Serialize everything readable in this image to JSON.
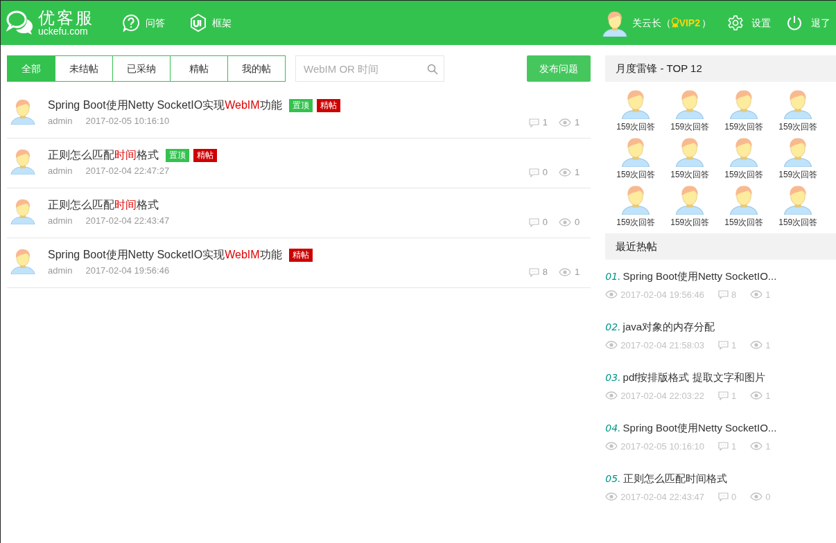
{
  "header": {
    "logo_title": "优客服",
    "logo_subtitle": "uckefu.com",
    "nav": [
      {
        "label": "问答"
      },
      {
        "label": "框架"
      }
    ],
    "user": {
      "name": "关云长（",
      "vip": "VIP2",
      "suffix": "）"
    },
    "actions": [
      {
        "label": "设置"
      },
      {
        "label": "退了"
      }
    ]
  },
  "tabs": [
    {
      "label": "全部",
      "selected": true
    },
    {
      "label": "未结帖",
      "selected": false
    },
    {
      "label": "已采纳",
      "selected": false
    },
    {
      "label": "精帖",
      "selected": false
    },
    {
      "label": "我的帖",
      "selected": false
    }
  ],
  "search": {
    "placeholder": "WebIM OR 时间"
  },
  "post_button": "发布问题",
  "posts": [
    {
      "title": [
        {
          "text": "Spring Boot使用Netty SocketIO实现",
          "highlight": false
        },
        {
          "text": "WebIM",
          "highlight": true
        },
        {
          "text": "功能",
          "highlight": false
        }
      ],
      "badges": [
        {
          "label": "置顶",
          "kind": "top"
        },
        {
          "label": "精帖",
          "kind": "featured"
        }
      ],
      "author": "admin",
      "date": "2017-02-05 10:16:10",
      "comments": "1",
      "views": "1"
    },
    {
      "title": [
        {
          "text": "正则怎么匹配",
          "highlight": false
        },
        {
          "text": "时间",
          "highlight": true
        },
        {
          "text": "格式",
          "highlight": false
        }
      ],
      "badges": [
        {
          "label": "置顶",
          "kind": "top"
        },
        {
          "label": "精帖",
          "kind": "featured"
        }
      ],
      "author": "admin",
      "date": "2017-02-04 22:47:27",
      "comments": "0",
      "views": "1"
    },
    {
      "title": [
        {
          "text": "正则怎么匹配",
          "highlight": false
        },
        {
          "text": "时间",
          "highlight": true
        },
        {
          "text": "格式",
          "highlight": false
        }
      ],
      "author": "admin",
      "date": "2017-02-04 22:43:47",
      "comments": "0",
      "views": "0"
    },
    {
      "title": [
        {
          "text": "Spring Boot使用Netty SocketIO实现",
          "highlight": false
        },
        {
          "text": "WebIM",
          "highlight": true
        },
        {
          "text": "功能",
          "highlight": false
        }
      ],
      "badges": [
        {
          "label": "精帖",
          "kind": "featured"
        }
      ],
      "author": "admin",
      "date": "2017-02-04 19:56:46",
      "comments": "8",
      "views": "1"
    }
  ],
  "top_users": {
    "title": "月度雷锋 - TOP 12",
    "users": [
      {
        "answers": "159次回答"
      },
      {
        "answers": "159次回答"
      },
      {
        "answers": "159次回答"
      },
      {
        "answers": "159次回答"
      },
      {
        "answers": "159次回答"
      },
      {
        "answers": "159次回答"
      },
      {
        "answers": "159次回答"
      },
      {
        "answers": "159次回答"
      },
      {
        "answers": "159次回答"
      },
      {
        "answers": "159次回答"
      },
      {
        "answers": "159次回答"
      },
      {
        "answers": "159次回答"
      }
    ]
  },
  "hot_posts": {
    "title": "最近热帖",
    "items": [
      {
        "number": "01.",
        "title": "Spring Boot使用Netty SocketIO...",
        "date": "2017-02-04 19:56:46",
        "comments": "8",
        "views": "1"
      },
      {
        "number": "02.",
        "title": "java对象的内存分配",
        "date": "2017-02-04 21:58:03",
        "comments": "1",
        "views": "1"
      },
      {
        "number": "03.",
        "title": "pdf按排版格式 提取文字和图片",
        "date": "2017-02-04 22:03:22",
        "comments": "1",
        "views": "1"
      },
      {
        "number": "04.",
        "title": "Spring Boot使用Netty SocketIO...",
        "date": "2017-02-05 10:16:10",
        "comments": "1",
        "views": "1"
      },
      {
        "number": "05.",
        "title": "正则怎么匹配时间格式",
        "date": "2017-02-04 22:43:47",
        "comments": "0",
        "views": "0"
      }
    ]
  }
}
